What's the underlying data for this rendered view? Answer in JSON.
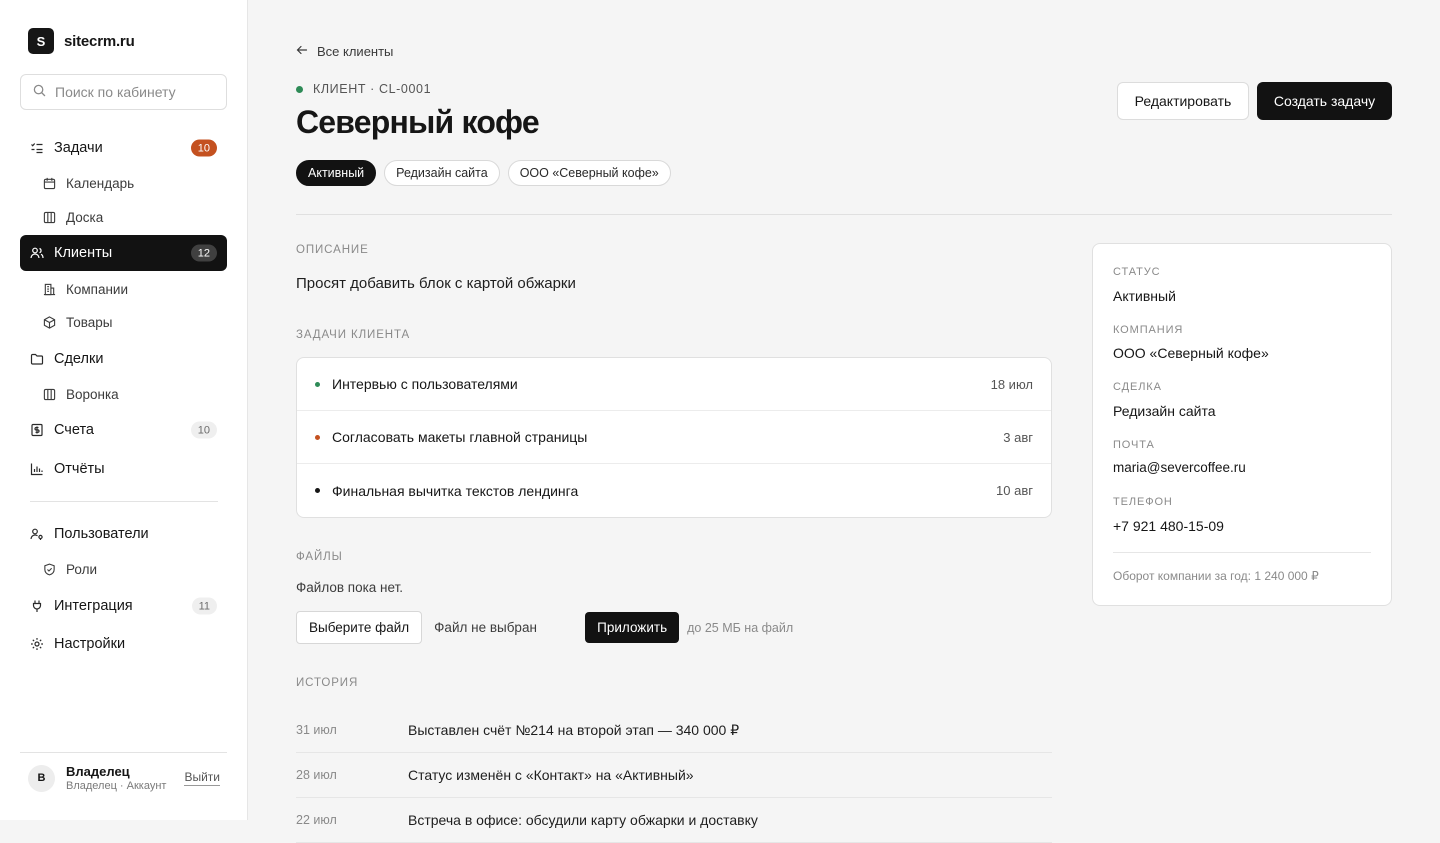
{
  "brand": {
    "logo_letter": "S",
    "name": "sitecrm.ru"
  },
  "search": {
    "placeholder": "Поиск по кабинету"
  },
  "nav": {
    "tasks": {
      "label": "Задачи",
      "badge": "10"
    },
    "calendar": {
      "label": "Календарь"
    },
    "board": {
      "label": "Доска"
    },
    "clients": {
      "label": "Клиенты",
      "badge": "12"
    },
    "companies": {
      "label": "Компании"
    },
    "products": {
      "label": "Товары"
    },
    "deals": {
      "label": "Сделки"
    },
    "funnel": {
      "label": "Воронка"
    },
    "invoices": {
      "label": "Счета",
      "badge": "10"
    },
    "reports": {
      "label": "Отчёты"
    },
    "users": {
      "label": "Пользователи"
    },
    "roles": {
      "label": "Роли"
    },
    "integration": {
      "label": "Интеграция",
      "badge": "11"
    },
    "settings": {
      "label": "Настройки"
    }
  },
  "user": {
    "initial": "В",
    "name": "Владелец",
    "role": "Владелец · Аккаунт",
    "logout": "Выйти"
  },
  "header": {
    "back": "Все клиенты",
    "eyebrow": "КЛИЕНТ · CL-0001",
    "title": "Северный кофе",
    "chips": [
      "Активный",
      "Редизайн сайта",
      "ООО «Северный кофе»"
    ],
    "edit_label": "Редактировать",
    "create_label": "Создать задачу"
  },
  "description": {
    "label": "ОПИСАНИЕ",
    "text": "Просят добавить блок с картой обжарки"
  },
  "tasks": {
    "label": "ЗАДАЧИ КЛИЕНТА",
    "items": [
      {
        "title": "Интервью с пользователями",
        "date": "18 июл",
        "color": "#2e8b57"
      },
      {
        "title": "Согласовать макеты главной страницы",
        "date": "3 авг",
        "color": "#c45120"
      },
      {
        "title": "Финальная вычитка текстов лендинга",
        "date": "10 авг",
        "color": "#161616"
      }
    ]
  },
  "files": {
    "label": "ФАЙЛЫ",
    "empty": "Файлов пока нет.",
    "choose_label": "Выберите файл",
    "none_label": "Файл не выбран",
    "attach_label": "Приложить",
    "hint": "до 25 МБ на файл"
  },
  "history": {
    "label": "ИСТОРИЯ",
    "items": [
      {
        "date": "31 июл",
        "text": "Выставлен счёт №214 на второй этап — 340 000 ₽"
      },
      {
        "date": "28 июл",
        "text": "Статус изменён с «Контакт» на «Активный»"
      },
      {
        "date": "22 июл",
        "text": "Встреча в офисе: обсудили карту обжарки и доставку"
      }
    ]
  },
  "info": {
    "status_label": "СТАТУС",
    "status": "Активный",
    "company_label": "КОМПАНИЯ",
    "company": "ООО «Северный кофе»",
    "deal_label": "СДЕЛКА",
    "deal": "Редизайн сайта",
    "email_label": "ПОЧТА",
    "email": "maria@severcoffee.ru",
    "phone_label": "ТЕЛЕФОН",
    "phone": "+7 921 480-15-09",
    "footer": "Оборот компании за год: 1 240 000 ₽"
  },
  "colors": {
    "accent_dark": "#121212",
    "status_green": "#2e8b57",
    "badge_orange": "#c45120",
    "background": "#f5f5f5"
  }
}
